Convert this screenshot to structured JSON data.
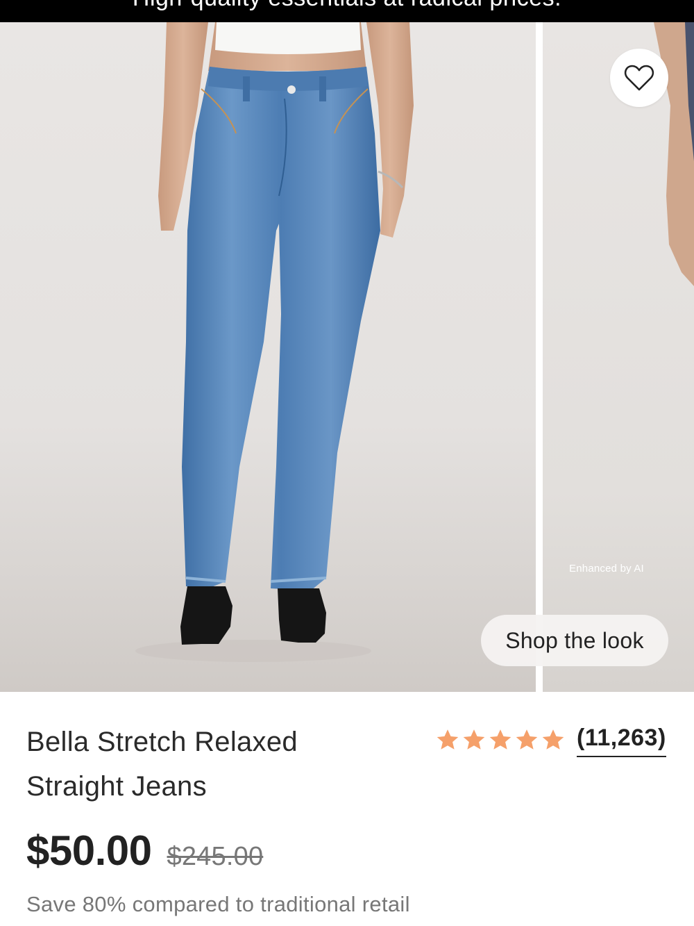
{
  "promo": {
    "text": "High-quality essentials at radical prices."
  },
  "gallery": {
    "badge": "Enhanced by AI",
    "shop_the_look": "Shop the look",
    "favorite_icon": "heart-outline-icon"
  },
  "product": {
    "title_line1": "Bella Stretch Relaxed",
    "title_line2": "Straight Jeans",
    "rating_stars": 5,
    "rating_count": "(11,263)",
    "price": "$50.00",
    "original_price": "$245.00",
    "savings": "Save 80% compared to traditional retail"
  },
  "colors": {
    "star": "#F5A06A",
    "banner": "#000000",
    "denim": "#5a88bd"
  }
}
